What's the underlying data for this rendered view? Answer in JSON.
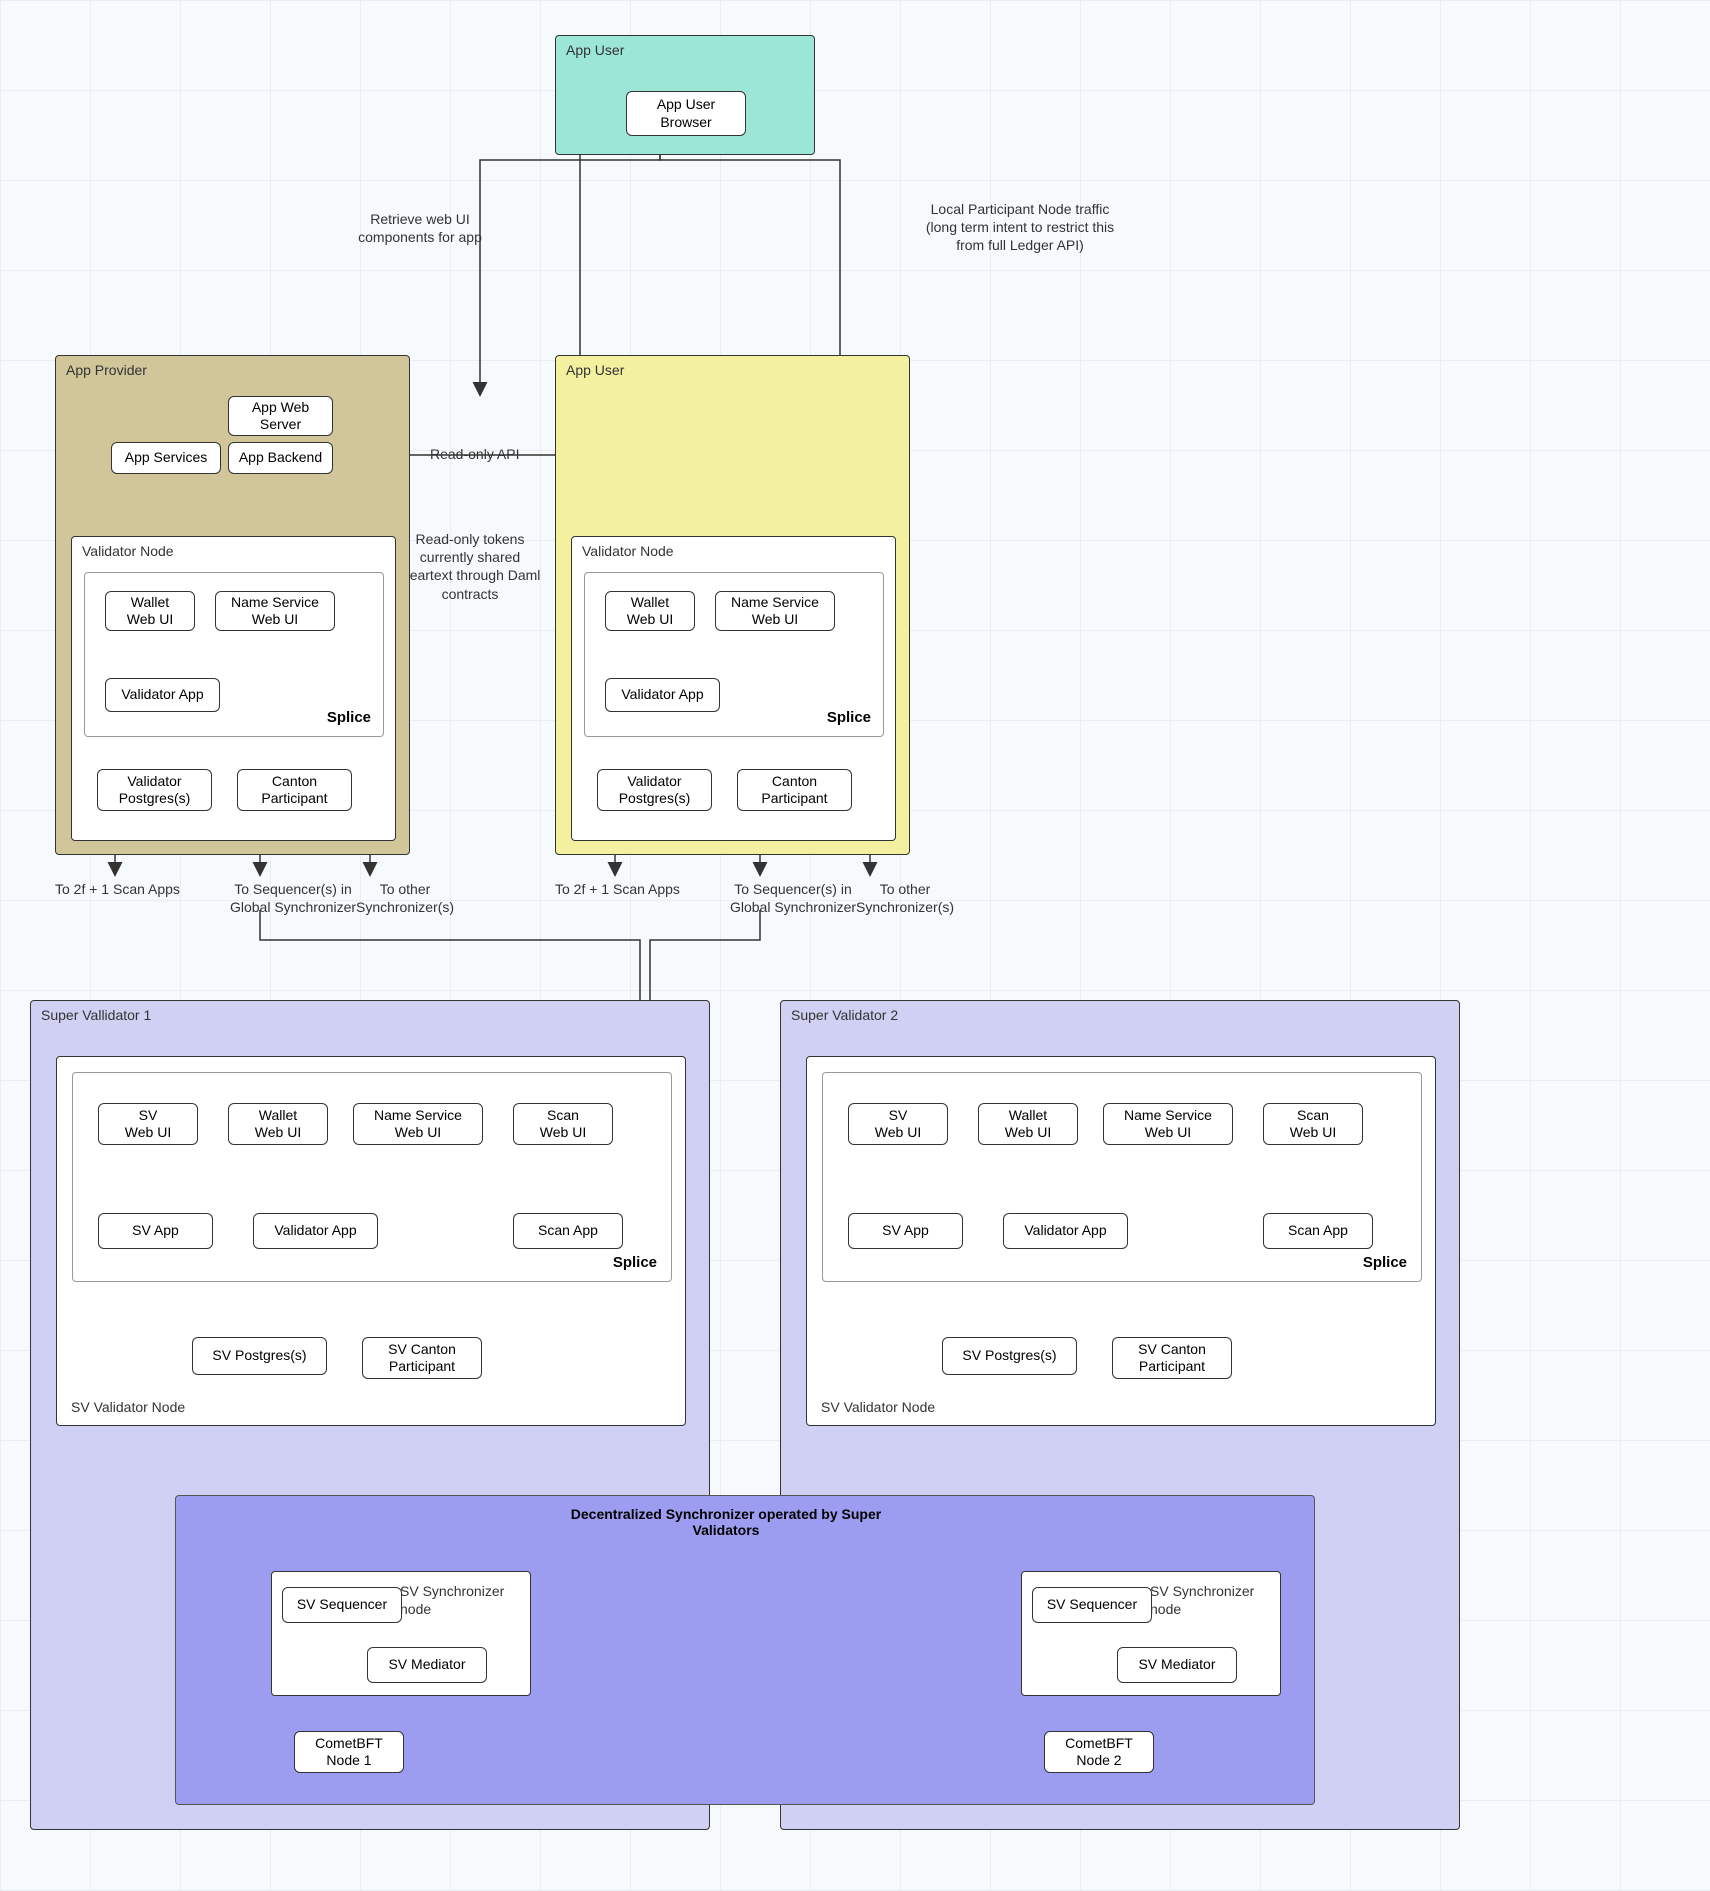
{
  "appUserTop": {
    "title": "App User",
    "browser": "App User\nBrowser"
  },
  "edgeLabels": {
    "retrieve": "Retrieve web UI\ncomponents for app",
    "localTraffic": "Local Participant Node traffic\n(long term intent to restrict this\nfrom full Ledger API)",
    "readOnlyApi": "Read-only API",
    "readOnlyTokens": "Read-only tokens\ncurrently shared\ncleartext through Daml\ncontracts",
    "toScan": "To 2f + 1 Scan Apps",
    "toSeq": "To Sequencer(s) in\nGlobal Synchronizer",
    "toOther": "To other\nSynchronizer(s)"
  },
  "appProvider": {
    "title": "App Provider",
    "webServer": "App Web\nServer",
    "services": "App Services",
    "backend": "App Backend"
  },
  "appUserRight": {
    "title": "App User"
  },
  "validatorNode": {
    "title": "Validator Node",
    "walletUI": "Wallet\nWeb UI",
    "nameServiceUI": "Name Service\nWeb UI",
    "validatorApp": "Validator App",
    "validatorPg": "Validator\nPostgres(s)",
    "cantonParticipant": "Canton\nParticipant",
    "splice": "Splice"
  },
  "sv": {
    "title1": "Super Vallidator 1",
    "title2": "Super Validator 2",
    "svNodeTitle": "SV Validator Node",
    "svWebUI": "SV\nWeb UI",
    "walletUI": "Wallet\nWeb UI",
    "nameServiceUI": "Name Service\nWeb UI",
    "scanUI": "Scan\nWeb UI",
    "svApp": "SV App",
    "validatorApp": "Validator App",
    "scanApp": "Scan App",
    "svPostgres": "SV Postgres(s)",
    "svCanton": "SV Canton\nParticipant",
    "splice": "Splice",
    "syncNode": "SV Synchronizer\nnode",
    "svSequencer": "SV Sequencer",
    "svMediator": "SV Mediator",
    "comet1": "CometBFT\nNode 1",
    "comet2": "CometBFT\nNode 2",
    "decentralized": "Decentralized Synchronizer operated by Super\nValidators"
  }
}
